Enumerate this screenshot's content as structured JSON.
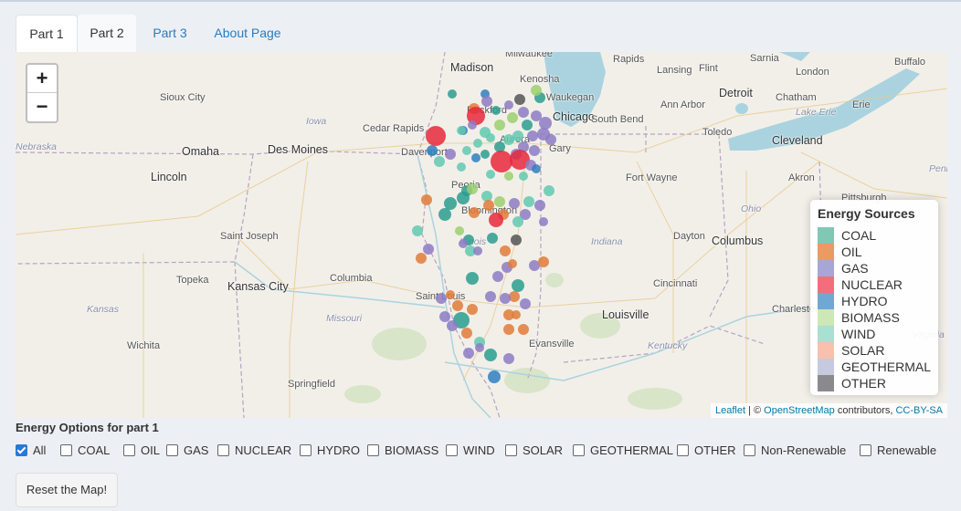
{
  "tabs": [
    {
      "label": "Part 1"
    },
    {
      "label": "Part 2"
    },
    {
      "label": "Part 3"
    },
    {
      "label": "About Page"
    }
  ],
  "map": {
    "zoom_in": "+",
    "zoom_out": "−",
    "places": [
      "Milwaukee",
      "Madison",
      "Kenosha",
      "Waukegan",
      "Rockford",
      "Chicago",
      "Aurora",
      "Gary",
      "Davenport",
      "Cedar Rapids",
      "Iowa",
      "Des Moines",
      "Omaha",
      "Sioux City",
      "Nebraska",
      "Lincoln",
      "Peoria",
      "Bloomington",
      "Illinois",
      "Saint Joseph",
      "Topeka",
      "Kansas City",
      "Columbia",
      "Missouri",
      "Kansas",
      "Wichita",
      "Springfield",
      "Saint Louis",
      "Evansville",
      "Louisville",
      "Kentucky",
      "Indiana",
      "Fort Wayne",
      "South Bend",
      "Lansing",
      "Flint",
      "Rapids",
      "Ann Arbor",
      "Detroit",
      "Toledo",
      "Chatham",
      "London",
      "Sarnia",
      "Lake Erie",
      "Erie",
      "Cleveland",
      "Akron",
      "Pittsburgh",
      "Ohio",
      "Dayton",
      "Columbus",
      "Cincinnati",
      "Charleston",
      "Buffalo",
      "Penn",
      "Virginia"
    ],
    "attribution": {
      "leaflet": "Leaflet",
      "sep1": " | © ",
      "osm": "OpenStreetMap",
      "contrib": " contributors, ",
      "license": "CC-BY-SA"
    }
  },
  "legend": {
    "title": "Energy Sources",
    "items": [
      {
        "label": "COAL",
        "color": "#7fc8b4"
      },
      {
        "label": "OIL",
        "color": "#eb9a62"
      },
      {
        "label": "GAS",
        "color": "#a8a6d6"
      },
      {
        "label": "NUCLEAR",
        "color": "#f36d7d"
      },
      {
        "label": "HYDRO",
        "color": "#6fa9d3"
      },
      {
        "label": "BIOMASS",
        "color": "#cde8b4"
      },
      {
        "label": "WIND",
        "color": "#a8e0d2"
      },
      {
        "label": "SOLAR",
        "color": "#f8c0ad"
      },
      {
        "label": "GEOTHERMAL",
        "color": "#c6cadf"
      },
      {
        "label": "OTHER",
        "color": "#8a8a8e"
      }
    ]
  },
  "options": {
    "title": "Energy Options for part 1",
    "items": [
      {
        "label": "All",
        "checked": true
      },
      {
        "label": "COAL",
        "checked": false
      },
      {
        "label": "OIL",
        "checked": false
      },
      {
        "label": "GAS",
        "checked": false
      },
      {
        "label": "NUCLEAR",
        "checked": false
      },
      {
        "label": "HYDRO",
        "checked": false
      },
      {
        "label": "BIOMASS",
        "checked": false
      },
      {
        "label": "WIND",
        "checked": false
      },
      {
        "label": "SOLAR",
        "checked": false
      },
      {
        "label": "GEOTHERMAL",
        "checked": false
      },
      {
        "label": "OTHER",
        "checked": false
      },
      {
        "label": "Non-Renewable",
        "checked": false
      },
      {
        "label": "Renewable",
        "checked": false
      }
    ]
  },
  "reset_label": "Reset the Map!",
  "colors": {
    "coal": "#2a9d8f",
    "oil": "#e07b39",
    "gas": "#8d7bc4",
    "nuclear": "#e8283c",
    "hydro": "#2f7fc1",
    "biomass": "#9ccf6f",
    "wind": "#63c9b0",
    "other": "#555"
  }
}
